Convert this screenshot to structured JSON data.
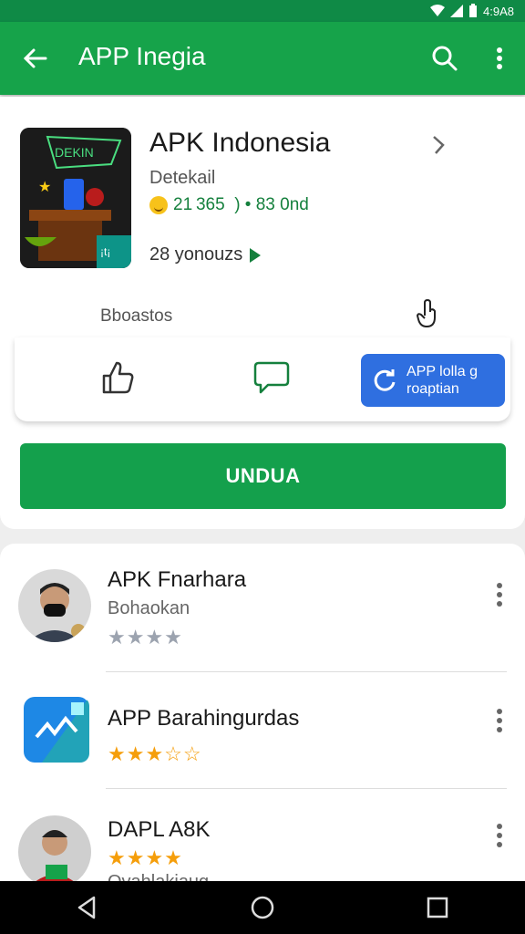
{
  "status": {
    "time": "4:9A8"
  },
  "appbar": {
    "title": "APP Inegia"
  },
  "app": {
    "name": "APK Indonesia",
    "developer": "Detekail",
    "stats": "21 365  ) • 83 0nd",
    "downloads": "28 yonouzs",
    "icon_text": "DEKIN",
    "icon_badge": "¡t¡"
  },
  "section_label": "Bboastos",
  "actions": {
    "blue_button": [
      "APP lolla g",
      "roaptian"
    ]
  },
  "download_button": "UNDUA",
  "list": [
    {
      "title": "APK Fnarhara",
      "subtitle": "Bohaokan",
      "stars": "★★★★",
      "stars_filled": 0,
      "thumb": "person-avatar"
    },
    {
      "title": "APP Barahingurdas",
      "subtitle": "",
      "stars": "★★★☆☆",
      "stars_filled": 3,
      "thumb": "app-icon"
    },
    {
      "title": "DAPL A8K",
      "subtitle": "Ovahlakiaug",
      "stars": "★★★★",
      "stars_filled": 4,
      "thumb": "person-avatar"
    }
  ],
  "colors": {
    "primary": "#16a34a",
    "status": "#0f8a46",
    "accent_blue": "#2f6fe0",
    "star": "#f59e0b"
  }
}
